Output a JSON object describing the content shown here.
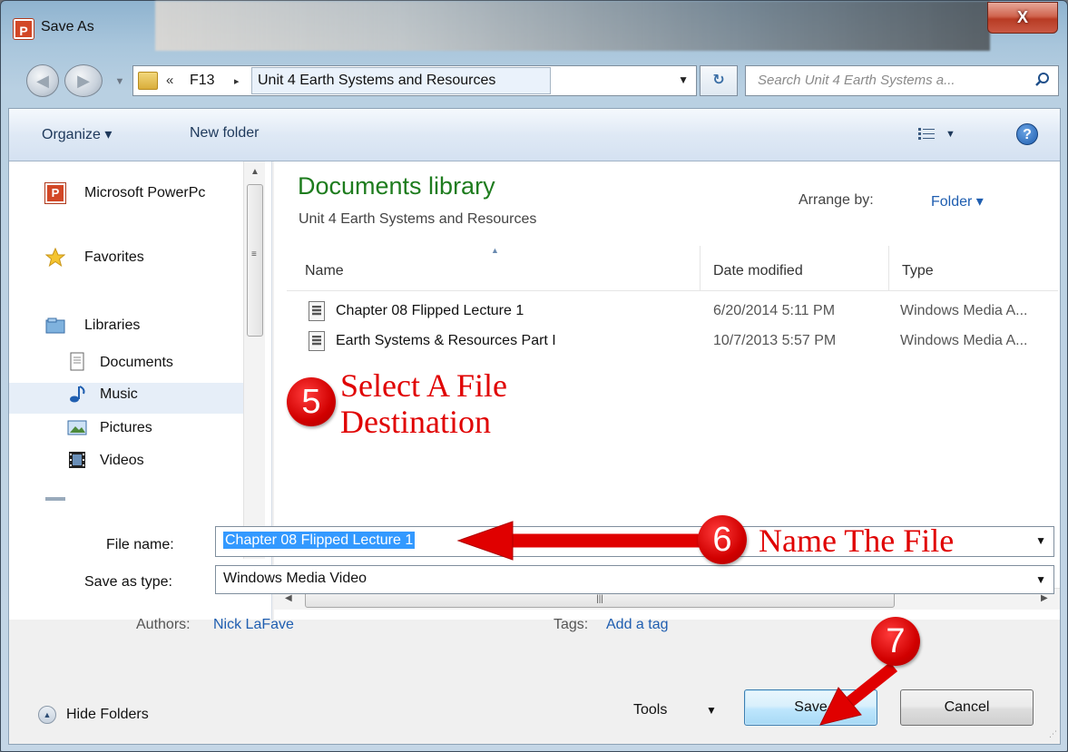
{
  "window": {
    "title": "Save As",
    "app_icon_letter": "P",
    "close_glyph": "X"
  },
  "address": {
    "overflow": "«",
    "crumbs": [
      "F13",
      "Unit 4 Earth Systems and Resources"
    ],
    "separator": "▸"
  },
  "search": {
    "placeholder": "Search Unit 4 Earth Systems a..."
  },
  "toolbar": {
    "organize": "Organize ▾",
    "new_folder": "New folder",
    "views_drop": "▼",
    "help": "?"
  },
  "nav": {
    "app_item": "Microsoft PowerPc",
    "favorites": "Favorites",
    "libraries": "Libraries",
    "items": [
      "Documents",
      "Music",
      "Pictures",
      "Videos"
    ]
  },
  "library": {
    "title": "Documents library",
    "subtitle": "Unit 4 Earth Systems and Resources",
    "arrange_label": "Arrange by:",
    "arrange_value": "Folder ▾"
  },
  "columns": {
    "name": "Name",
    "date": "Date modified",
    "type": "Type"
  },
  "files": [
    {
      "name": "Chapter 08 Flipped Lecture 1",
      "date": "6/20/2014 5:11 PM",
      "type": "Windows Media A..."
    },
    {
      "name": "Earth Systems & Resources Part I",
      "date": "10/7/2013 5:57 PM",
      "type": "Windows Media A..."
    }
  ],
  "form": {
    "file_name_label": "File name:",
    "file_name_value": "Chapter 08 Flipped Lecture 1",
    "save_type_label": "Save as type:",
    "save_type_value": "Windows Media Video",
    "authors_label": "Authors:",
    "authors_value": "Nick LaFave",
    "tags_label": "Tags:",
    "tags_value": "Add a tag"
  },
  "footer": {
    "hide_folders": "Hide Folders",
    "tools": "Tools",
    "save": "Save",
    "cancel": "Cancel"
  },
  "annotations": {
    "step5_num": "5",
    "step5_line1": "Select A File",
    "step5_line2": "Destination",
    "step6_num": "6",
    "step6_text": "Name The File",
    "step7_num": "7"
  },
  "colors": {
    "annotation_red": "#e00000",
    "library_green": "#1e7c1e",
    "link_blue": "#1f5eb0",
    "selection_blue": "#3399ff"
  }
}
